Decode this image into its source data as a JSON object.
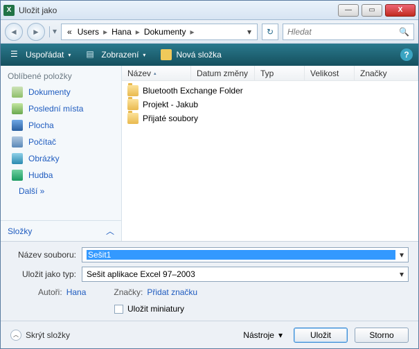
{
  "title": "Uložit jako",
  "winbtns": {
    "min": "—",
    "max": "▭",
    "close": "X"
  },
  "nav": {
    "back": "◄",
    "fwd": "►",
    "dd": "▾"
  },
  "breadcrumb": {
    "prefix": "«",
    "segs": [
      "Users",
      "Hana",
      "Dokumenty"
    ],
    "sep": "▸",
    "dd": "▾",
    "refresh": "↻"
  },
  "search": {
    "placeholder": "Hledat",
    "icon": "🔍"
  },
  "toolbar": {
    "organize": "Uspořádat",
    "views": "Zobrazení",
    "newfolder": "Nová složka",
    "dd": "▾",
    "help": "?"
  },
  "sidebar": {
    "favhdr": "Oblíbené položky",
    "items": [
      {
        "label": "Dokumenty"
      },
      {
        "label": "Poslední místa"
      },
      {
        "label": "Plocha"
      },
      {
        "label": "Počítač"
      },
      {
        "label": "Obrázky"
      },
      {
        "label": "Hudba"
      }
    ],
    "more": "Další  »",
    "folders": "Složky",
    "chev": "︿"
  },
  "columns": {
    "name": "Název",
    "modified": "Datum změny",
    "type": "Typ",
    "size": "Velikost",
    "tags": "Značky",
    "asc": "▴"
  },
  "files": [
    "Bluetooth Exchange Folder",
    "Projekt - Jakub",
    "Přijaté soubory"
  ],
  "bottom": {
    "namelabel": "Název souboru:",
    "name": "Sešit1",
    "typelabel": "Uložit jako typ:",
    "type": "Sešit aplikace Excel 97–2003",
    "authorslabel": "Autoři:",
    "authors": "Hana",
    "tagslabel": "Značky:",
    "tags": "Přidat značku",
    "thumb": "Uložit miniatury",
    "dd": "▾"
  },
  "footer": {
    "hide": "Skrýt složky",
    "chev": "︿",
    "tools": "Nástroje",
    "dd": "▾",
    "save": "Uložit",
    "cancel": "Storno"
  }
}
